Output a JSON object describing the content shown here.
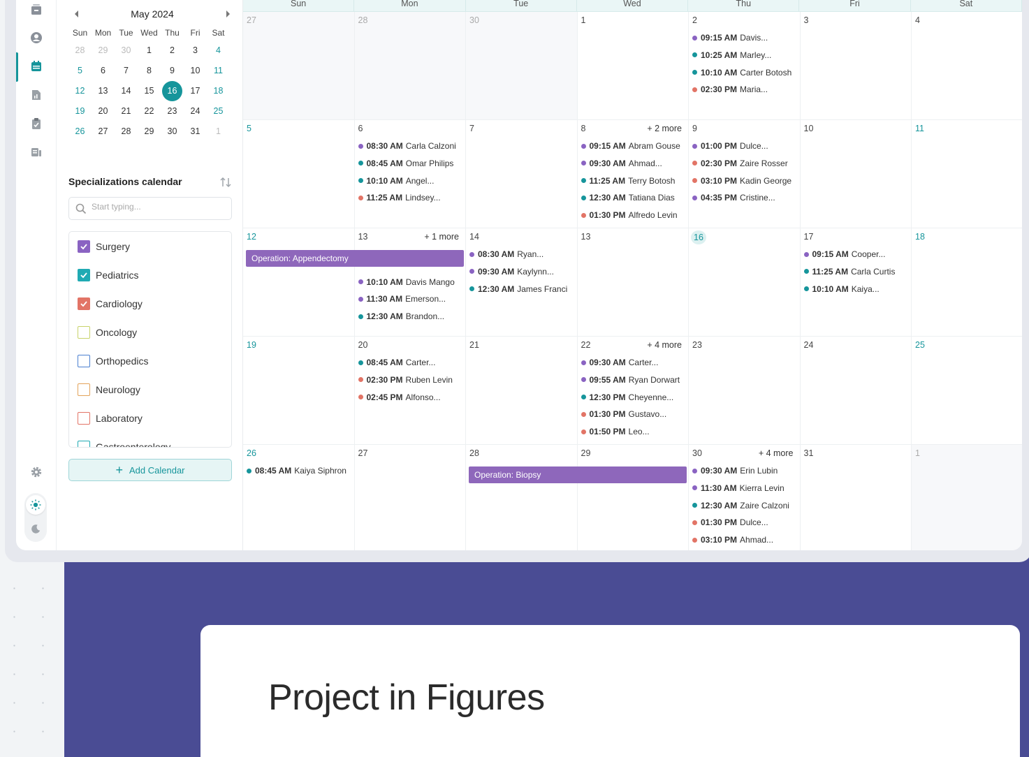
{
  "colors": {
    "teal": "#16959b",
    "purple": "#8a63c2",
    "red": "#e27466",
    "band": "#4a4c94",
    "op_bar": "#8e67bb"
  },
  "rail": {
    "icons": [
      "inbox-icon",
      "user-icon",
      "calendar-icon",
      "report-icon",
      "clipboard-icon",
      "device-icon",
      "gear-icon",
      "sun-icon",
      "moon-icon"
    ],
    "active": "calendar-icon"
  },
  "mini_calendar": {
    "title": "May 2024",
    "weekdays": [
      "Sun",
      "Mon",
      "Tue",
      "Wed",
      "Thu",
      "Fri",
      "Sat"
    ],
    "days": [
      {
        "d": "28",
        "s": "muted"
      },
      {
        "d": "29",
        "s": "muted"
      },
      {
        "d": "30",
        "s": "muted"
      },
      {
        "d": "1"
      },
      {
        "d": "2"
      },
      {
        "d": "3"
      },
      {
        "d": "4",
        "s": "wkd"
      },
      {
        "d": "5",
        "s": "wkd"
      },
      {
        "d": "6"
      },
      {
        "d": "7"
      },
      {
        "d": "8"
      },
      {
        "d": "9"
      },
      {
        "d": "10"
      },
      {
        "d": "11",
        "s": "wkd"
      },
      {
        "d": "12",
        "s": "wkd"
      },
      {
        "d": "13"
      },
      {
        "d": "14"
      },
      {
        "d": "15"
      },
      {
        "d": "16",
        "s": "today"
      },
      {
        "d": "17"
      },
      {
        "d": "18",
        "s": "wkd"
      },
      {
        "d": "19",
        "s": "wkd"
      },
      {
        "d": "20"
      },
      {
        "d": "21"
      },
      {
        "d": "22"
      },
      {
        "d": "23"
      },
      {
        "d": "24"
      },
      {
        "d": "25",
        "s": "wkd"
      },
      {
        "d": "26",
        "s": "wkd"
      },
      {
        "d": "27"
      },
      {
        "d": "28"
      },
      {
        "d": "29"
      },
      {
        "d": "30"
      },
      {
        "d": "31"
      },
      {
        "d": "1",
        "s": "muted"
      }
    ]
  },
  "specializations": {
    "title": "Specializations calendar",
    "search_placeholder": "Start typing...",
    "items": [
      {
        "label": "Surgery",
        "checked": true,
        "color": "#8a63c2"
      },
      {
        "label": "Pediatrics",
        "checked": true,
        "color": "#20aab3"
      },
      {
        "label": "Cardiology",
        "checked": true,
        "color": "#e27466"
      },
      {
        "label": "Oncology",
        "checked": false,
        "color": "#c8d36a"
      },
      {
        "label": "Orthopedics",
        "checked": false,
        "color": "#4a7fd0"
      },
      {
        "label": "Neurology",
        "checked": false,
        "color": "#e3a35a"
      },
      {
        "label": "Laboratory",
        "checked": false,
        "color": "#e27466"
      },
      {
        "label": "Gastroenterology",
        "checked": false,
        "color": "#20aab3"
      }
    ],
    "add_button": "Add Calendar"
  },
  "calendar": {
    "weekdays": [
      "Sun",
      "Mon",
      "Tue",
      "Wed",
      "Thu",
      "Fri",
      "Sat"
    ],
    "weeks": [
      [
        {
          "d": "27",
          "style": "muted",
          "dim": true
        },
        {
          "d": "28",
          "style": "muted",
          "dim": true
        },
        {
          "d": "30",
          "style": "muted",
          "dim": true
        },
        {
          "d": "1"
        },
        {
          "d": "2",
          "events": [
            {
              "time": "09:15 AM",
              "name": "Davis...",
              "c": "purple"
            },
            {
              "time": "10:25 AM",
              "name": "Marley...",
              "c": "teal"
            },
            {
              "time": "10:10 AM",
              "name": "Carter Botosh",
              "c": "teal"
            },
            {
              "time": "02:30 PM",
              "name": "Maria...",
              "c": "red"
            }
          ]
        },
        {
          "d": "3"
        },
        {
          "d": "4"
        }
      ],
      [
        {
          "d": "5",
          "style": "wkd"
        },
        {
          "d": "6",
          "events": [
            {
              "time": "08:30 AM",
              "name": "Carla Calzoni",
              "c": "purple"
            },
            {
              "time": "08:45 AM",
              "name": "Omar Philips",
              "c": "teal"
            },
            {
              "time": "10:10 AM",
              "name": "Angel...",
              "c": "teal"
            },
            {
              "time": "11:25 AM",
              "name": "Lindsey...",
              "c": "red"
            }
          ]
        },
        {
          "d": "7"
        },
        {
          "d": "8",
          "more": "+ 2 more",
          "events": [
            {
              "time": "09:15 AM",
              "name": "Abram Gouse",
              "c": "purple"
            },
            {
              "time": "09:30 AM",
              "name": "Ahmad...",
              "c": "purple"
            },
            {
              "time": "11:25 AM",
              "name": "Terry Botosh",
              "c": "teal"
            },
            {
              "time": "12:30 AM",
              "name": "Tatiana Dias",
              "c": "teal"
            },
            {
              "time": "01:30 PM",
              "name": "Alfredo Levin",
              "c": "red"
            }
          ]
        },
        {
          "d": "9",
          "events": [
            {
              "time": "01:00 PM",
              "name": "Dulce...",
              "c": "purple"
            },
            {
              "time": "02:30 PM",
              "name": "Zaire Rosser",
              "c": "red"
            },
            {
              "time": "03:10 PM",
              "name": "Kadin George",
              "c": "red"
            },
            {
              "time": "04:35 PM",
              "name": "Cristine...",
              "c": "purple"
            }
          ]
        },
        {
          "d": "10"
        },
        {
          "d": "11",
          "style": "wkd"
        }
      ],
      [
        {
          "d": "12",
          "style": "wkd"
        },
        {
          "d": "13",
          "more": "+ 1 more",
          "events": [
            {
              "time": "10:10 AM",
              "name": "Davis Mango",
              "c": "purple",
              "slot": 2.6
            },
            {
              "time": "11:30 AM",
              "name": "Emerson...",
              "c": "purple",
              "slot": 3.6
            },
            {
              "time": "12:30 AM",
              "name": "Brandon...",
              "c": "teal",
              "slot": 4.6
            }
          ]
        },
        {
          "d": "14",
          "events": [
            {
              "time": "08:30 AM",
              "name": "Ryan...",
              "c": "purple"
            },
            {
              "time": "09:30 AM",
              "name": "Kaylynn...",
              "c": "purple"
            },
            {
              "time": "12:30 AM",
              "name": "James Franci",
              "c": "teal"
            }
          ]
        },
        {
          "d": "13"
        },
        {
          "d": "16",
          "style": "today"
        },
        {
          "d": "17",
          "events": [
            {
              "time": "09:15 AM",
              "name": "Cooper...",
              "c": "purple"
            },
            {
              "time": "11:25 AM",
              "name": "Carla Curtis",
              "c": "teal"
            },
            {
              "time": "10:10 AM",
              "name": "Kaiya...",
              "c": "teal"
            }
          ]
        },
        {
          "d": "18",
          "style": "wkd"
        }
      ],
      [
        {
          "d": "19",
          "style": "wkd"
        },
        {
          "d": "20",
          "events": [
            {
              "time": "08:45 AM",
              "name": "Carter...",
              "c": "teal"
            },
            {
              "time": "02:30 PM",
              "name": "Ruben Levin",
              "c": "red"
            },
            {
              "time": "02:45 PM",
              "name": "Alfonso...",
              "c": "red"
            }
          ]
        },
        {
          "d": "21"
        },
        {
          "d": "22",
          "more": "+ 4 more",
          "events": [
            {
              "time": "09:30 AM",
              "name": "Carter...",
              "c": "purple"
            },
            {
              "time": "09:55 AM",
              "name": "Ryan Dorwart",
              "c": "purple"
            },
            {
              "time": "12:30 PM",
              "name": "Cheyenne...",
              "c": "teal"
            },
            {
              "time": "01:30 PM",
              "name": "Gustavo...",
              "c": "red"
            },
            {
              "time": "01:50 PM",
              "name": "Leo...",
              "c": "red"
            }
          ]
        },
        {
          "d": "23"
        },
        {
          "d": "24"
        },
        {
          "d": "25",
          "style": "wkd"
        }
      ],
      [
        {
          "d": "26",
          "style": "wkd",
          "events": [
            {
              "time": "08:45 AM",
              "name": "Kaiya Siphron",
              "c": "teal"
            }
          ]
        },
        {
          "d": "27"
        },
        {
          "d": "28"
        },
        {
          "d": "29"
        },
        {
          "d": "30",
          "more": "+ 4 more",
          "events": [
            {
              "time": "09:30 AM",
              "name": "Erin Lubin",
              "c": "purple"
            },
            {
              "time": "11:30 AM",
              "name": "Kierra Levin",
              "c": "purple"
            },
            {
              "time": "12:30 AM",
              "name": "Zaire Calzoni",
              "c": "teal"
            },
            {
              "time": "01:30 PM",
              "name": "Dulce...",
              "c": "red"
            },
            {
              "time": "03:10 PM",
              "name": "Ahmad...",
              "c": "red"
            }
          ]
        },
        {
          "d": "31"
        },
        {
          "d": "1",
          "style": "muted",
          "dim": true
        }
      ]
    ],
    "operations": [
      {
        "label": "Operation: Appendectomy",
        "week": 2,
        "from": 0,
        "to": 1
      },
      {
        "label": "Operation: Biopsy",
        "week": 4,
        "from": 2,
        "to": 3
      }
    ]
  },
  "figures": {
    "title": "Project in Figures"
  }
}
